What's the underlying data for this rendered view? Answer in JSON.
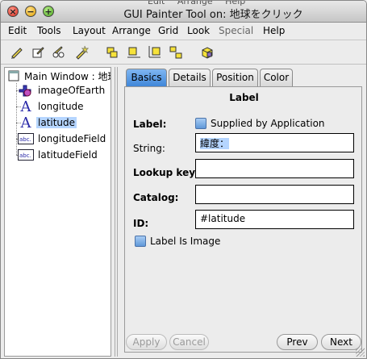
{
  "title": "GUI Painter Tool on: 地球をクリック",
  "background_menu": [
    "Edit",
    "Arrange",
    "Help"
  ],
  "menu": [
    {
      "label": "Edit",
      "enabled": true
    },
    {
      "label": "Tools",
      "enabled": true
    },
    {
      "label": "Layout",
      "enabled": true
    },
    {
      "label": "Arrange",
      "enabled": true
    },
    {
      "label": "Grid",
      "enabled": true
    },
    {
      "label": "Look",
      "enabled": true
    },
    {
      "label": "Special",
      "enabled": false
    },
    {
      "label": "Help",
      "enabled": true
    }
  ],
  "toolbar": [
    "select-tool-icon",
    "edit-tool-icon",
    "group-tool-icon",
    "magic-tool-icon",
    "align-left-icon",
    "align-center-icon",
    "align-right-icon",
    "distribute-icon",
    "cube-icon"
  ],
  "tree": {
    "root": "Main Window : 地球",
    "items": [
      {
        "label": "imageOfEarth",
        "icon": "image-icon",
        "selected": false
      },
      {
        "label": "longitude",
        "icon": "label-a-icon",
        "selected": false
      },
      {
        "label": "latitude",
        "icon": "label-a-icon",
        "selected": true
      },
      {
        "label": "longitudeField",
        "icon": "input-field-icon",
        "selected": false
      },
      {
        "label": "latitudeField",
        "icon": "input-field-icon",
        "selected": false
      }
    ]
  },
  "tabs": [
    {
      "label": "Basics",
      "active": true
    },
    {
      "label": "Details",
      "active": false
    },
    {
      "label": "Position",
      "active": false
    },
    {
      "label": "Color",
      "active": false
    }
  ],
  "basics": {
    "section_title": "Label",
    "label_label": "Label:",
    "supplied_by_app": "Supplied by Application",
    "string_label": "String:",
    "string_value": "緯度：",
    "lookup_label": "Lookup key:",
    "lookup_value": "",
    "catalog_label": "Catalog:",
    "catalog_value": "",
    "id_label": "ID:",
    "id_value": "#latitude",
    "label_is_image": "Label Is Image"
  },
  "buttons": {
    "apply": "Apply",
    "cancel": "Cancel",
    "prev": "Prev",
    "next": "Next"
  },
  "colors": {
    "accent": "#3f86d8",
    "selection": "#b5d5ff"
  }
}
